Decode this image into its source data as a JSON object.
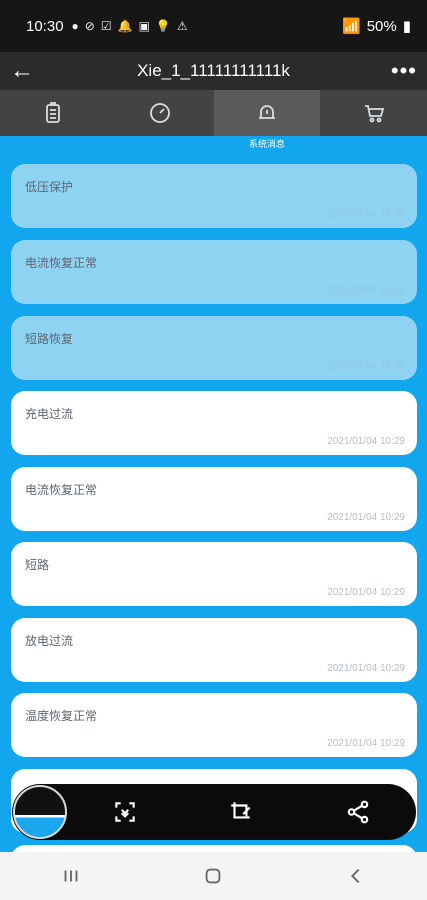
{
  "status_bar": {
    "time": "10:30",
    "battery": "50%"
  },
  "app_bar": {
    "title": "Xie_1_11111111111k"
  },
  "tabs": {
    "active_label": "系统消息"
  },
  "messages": [
    {
      "title": "低压保护",
      "time": "2021/01/04 10:30",
      "state": "unread"
    },
    {
      "title": "电流恢复正常",
      "time": "2021/01/04 10:30",
      "state": "unread"
    },
    {
      "title": "短路恢复",
      "time": "2021/01/04 10:30",
      "state": "unread"
    },
    {
      "title": "充电过流",
      "time": "2021/01/04 10:29",
      "state": "read"
    },
    {
      "title": "电流恢复正常",
      "time": "2021/01/04 10:29",
      "state": "read"
    },
    {
      "title": "短路",
      "time": "2021/01/04 10:29",
      "state": "read"
    },
    {
      "title": "放电过流",
      "time": "2021/01/04 10:29",
      "state": "read"
    },
    {
      "title": "温度恢复正常",
      "time": "2021/01/04 10:29",
      "state": "read"
    }
  ],
  "colors": {
    "unread_card": "#8fd3f3",
    "read_card": "#ffffff",
    "background": "#11a6ee"
  }
}
